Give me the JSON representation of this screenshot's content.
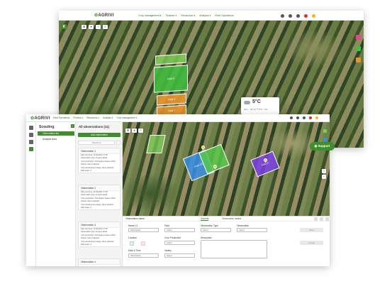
{
  "back_window": {
    "logo": "AGRIVI",
    "nav": [
      "Crop management ▾",
      "Finance ▾",
      "Resources ▾",
      "Analysis ▾",
      "Field Operations"
    ],
    "fields": [
      {
        "label": "",
        "color": "#7ccf55"
      },
      {
        "label": "Field 9",
        "color": "#3fbf3f"
      },
      {
        "label": "Field 4",
        "color": "#e8932c"
      },
      {
        "label": "Field 7",
        "color": "#e8932c"
      },
      {
        "label": "",
        "color": "#e04a8a"
      }
    ],
    "weather": {
      "temp": "5°C",
      "meta": "Mon ↑ 8km/h  ☂ 0%  ◌ 0%"
    },
    "toolbar": [
      "⊞",
      "▾",
      "+",
      "≡"
    ]
  },
  "front_window": {
    "logo": "AGRIVI",
    "nav": [
      "Field Operations",
      "Finance ▾",
      "Resources ▾",
      "Analysis ▾",
      "Crop management ▾"
    ],
    "scouting": {
      "title": "Scouting",
      "items": [
        "Observation list",
        "Analysis Area"
      ]
    },
    "observations": {
      "title": "All observations (11)",
      "add_label": "Add observation",
      "filter_label": "Sort by ▾",
      "cards": [
        {
          "title": "Observation 1",
          "lines": [
            "Date and time: 13.09.2022 17:00",
            "Observation type: Fungus attack",
            "Crop production: Soft apples Season 2022",
            "Variety: None selected",
            "Crop development stage: None selected",
            "Risk scale: 3"
          ]
        },
        {
          "title": "Observation 2",
          "lines": [
            "Date and time: 13.09.2022 17:00",
            "Observation type: Fungus attack",
            "Crop production: Soft apples Season 2022",
            "Variety: None selected",
            "Crop development stage: None selected",
            "Risk scale: 3"
          ]
        },
        {
          "title": "Observation 3",
          "lines": [
            "Date and time: 13.09.2022 17:00",
            "Observation type: Fungus attack",
            "Crop production: Soft apples Season 2022",
            "Variety: None selected",
            "Crop development stage: None selected",
            "Risk scale: 3"
          ]
        },
        {
          "title": "Observation 4",
          "lines": []
        }
      ]
    },
    "map_fields": [
      {
        "label": "",
        "color": "#7ccf55"
      },
      {
        "label": "Field 28",
        "color": "#3a8ee6"
      },
      {
        "label": "",
        "color": "#57c84a"
      },
      {
        "label": "Field 6",
        "color": "#7b3fe4"
      }
    ],
    "support_label": "Support",
    "form": {
      "title": "Observation name",
      "tabs": [
        "General",
        "Observation details"
      ],
      "name_label": "Name (*)",
      "name_placeholder": "Placeholder",
      "field_label": "Field",
      "field_value": "Select",
      "obs_type_label": "Observation Type",
      "obs_type_value": "Select",
      "observation_label": "Observation",
      "observation_value": "Select",
      "location_label": "Location",
      "crop_prod_label": "Crop Production",
      "crop_prod_value": "Select",
      "description_label": "Description",
      "date_label": "Date & Time",
      "date_placeholder": "Placeholder",
      "variety_label": "Variety",
      "variety_value": "Select",
      "save_label": "Save",
      "cancel_label": "Cancel"
    }
  }
}
